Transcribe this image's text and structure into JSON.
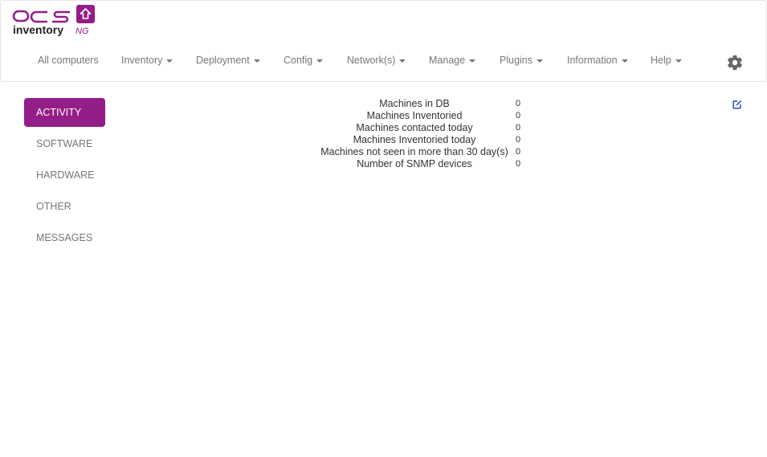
{
  "logo": {
    "text_top": "OCS",
    "text_bottom": "inventory",
    "suffix": "NG"
  },
  "nav": {
    "items": [
      {
        "label": "All computers",
        "dropdown": false
      },
      {
        "label": "Inventory",
        "dropdown": true
      },
      {
        "label": "Deployment",
        "dropdown": true
      },
      {
        "label": "Config",
        "dropdown": true
      },
      {
        "label": "Network(s)",
        "dropdown": true
      },
      {
        "label": "Manage",
        "dropdown": true
      },
      {
        "label": "Plugins",
        "dropdown": true
      },
      {
        "label": "Information",
        "dropdown": true
      },
      {
        "label": "Help",
        "dropdown": true
      }
    ],
    "settings_icon": "gear-icon"
  },
  "sidebar": {
    "items": [
      {
        "label": "ACTIVITY",
        "active": true
      },
      {
        "label": "SOFTWARE",
        "active": false
      },
      {
        "label": "HARDWARE",
        "active": false
      },
      {
        "label": "OTHER",
        "active": false
      },
      {
        "label": "MESSAGES",
        "active": false
      }
    ]
  },
  "stats": {
    "rows": [
      {
        "label": "Machines in DB",
        "value": "0"
      },
      {
        "label": "Machines Inventoried",
        "value": "0"
      },
      {
        "label": "Machines contacted today",
        "value": "0"
      },
      {
        "label": "Machines Inventoried today",
        "value": "0"
      },
      {
        "label": "Machines not seen in more than 30 day(s)",
        "value": "0"
      },
      {
        "label": "Number of SNMP devices",
        "value": "0"
      }
    ]
  },
  "edit_icon": "edit-icon",
  "colors": {
    "brand": "#941e87",
    "nav_text": "#777777",
    "edit_icon": "#1a3fb5"
  }
}
